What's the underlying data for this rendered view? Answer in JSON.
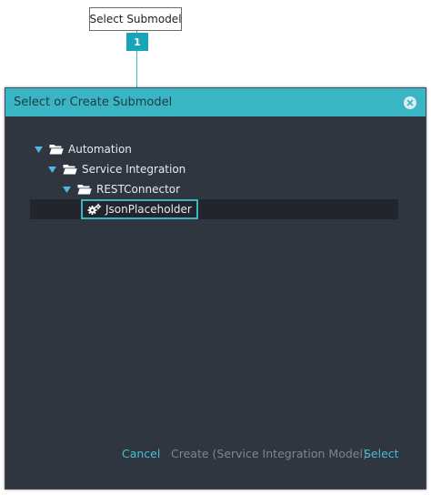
{
  "callout": {
    "label": "Select Submodel",
    "number": "1"
  },
  "dialog": {
    "title": "Select or Create Submodel",
    "close_icon": "close-circle-icon"
  },
  "tree": {
    "nodes": [
      {
        "label": "Automation",
        "icon": "folder-open-icon",
        "expanded": true
      },
      {
        "label": "Service Integration",
        "icon": "folder-open-icon",
        "expanded": true
      },
      {
        "label": "RESTConnector",
        "icon": "folder-open-icon",
        "expanded": true
      },
      {
        "label": "JsonPlaceholder",
        "icon": "gears-icon",
        "selected": true
      }
    ]
  },
  "footer": {
    "cancel_label": "Cancel",
    "create_label": "Create (Service Integration Model)",
    "select_label": "Select"
  },
  "colors": {
    "accent": "#3ab5c4",
    "dialog_bg": "#2f3640",
    "selected_row_bg": "#22262c",
    "disabled_text": "#7d858f"
  }
}
